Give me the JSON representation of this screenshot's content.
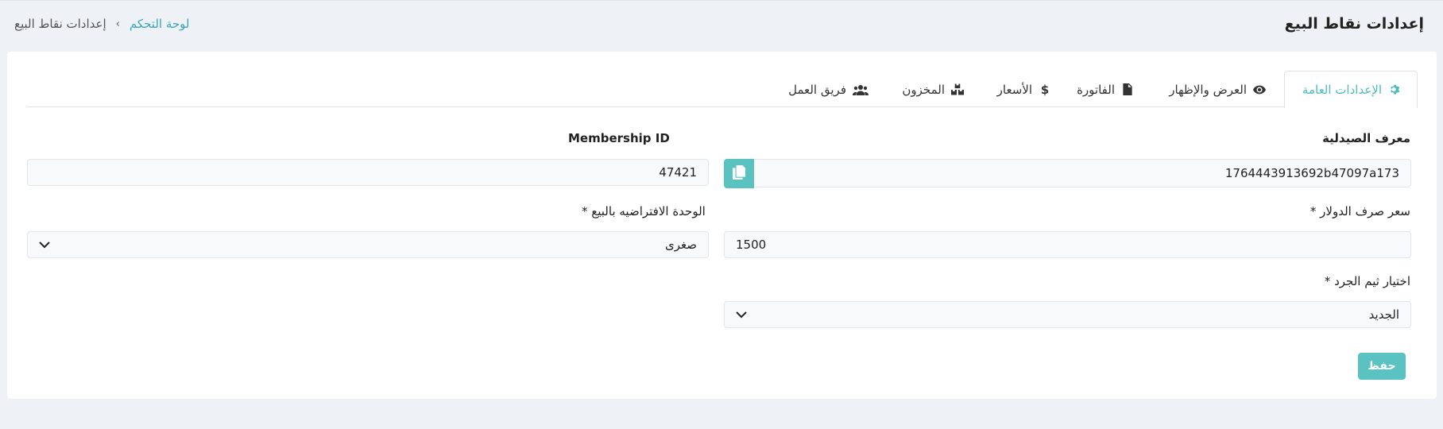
{
  "header": {
    "title": "إعدادات نقاط البيع",
    "breadcrumb": {
      "home": "لوحة التحكم",
      "separator": "›",
      "current": "إعدادات نقاط البيع"
    }
  },
  "tabs": [
    {
      "label": "الإعدادات العامة",
      "icon": "gear-icon",
      "active": true
    },
    {
      "label": "العرض والإظهار",
      "icon": "eye-icon",
      "active": false
    },
    {
      "label": "الفاتورة",
      "icon": "invoice-icon",
      "active": false
    },
    {
      "label": "الأسعار",
      "icon": "dollar-icon",
      "active": false
    },
    {
      "label": "المخزون",
      "icon": "boxes-icon",
      "active": false
    },
    {
      "label": "فريق العمل",
      "icon": "users-icon",
      "active": false
    }
  ],
  "form": {
    "pharmacy_id": {
      "label": "معرف الصيدلية",
      "value": "1764443913692b47097a173"
    },
    "membership_id": {
      "label": "Membership ID",
      "value": "47421"
    },
    "usd_rate": {
      "label": "سعر صرف الدولار *",
      "value": "1500"
    },
    "default_unit": {
      "label": "الوحدة الافتراضيه بالبيع *",
      "value": "صغرى"
    },
    "inventory_theme": {
      "label": "اختيار ثيم الجرد *",
      "value": "الجديد"
    },
    "save_label": "حفظ"
  },
  "colors": {
    "accent": "#5bc2c2",
    "link": "#3aa6b7",
    "background": "#eef1f5"
  }
}
